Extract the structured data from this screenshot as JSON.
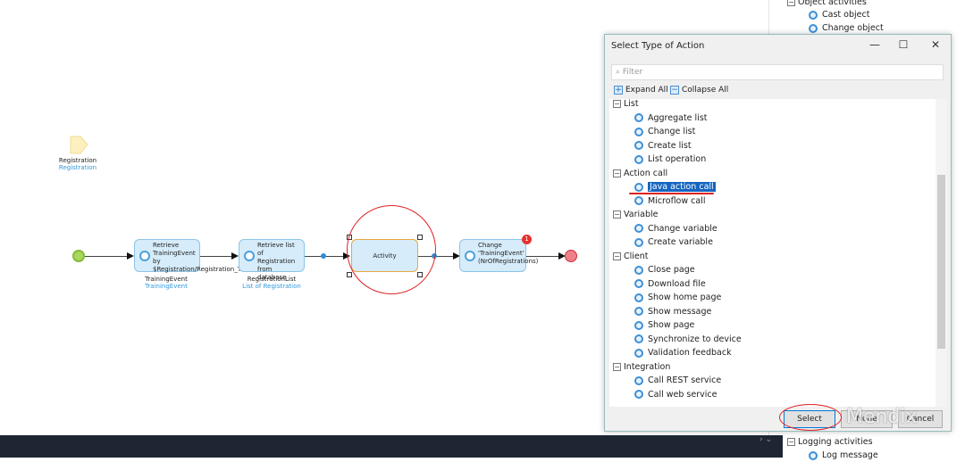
{
  "canvas": {
    "parameter": {
      "name": "Registration",
      "type": "Registration"
    },
    "activities": [
      {
        "text": "Retrieve TrainingEvent by $Registration/Registration_Traini",
        "var": "TrainingEvent",
        "type": "TrainingEvent"
      },
      {
        "text": "Retrieve list of Registration from database",
        "var": "RegistrationList",
        "type": "List of Registration"
      },
      {
        "text": "Activity"
      },
      {
        "text": "Change 'TrainingEvent' (NrOfRegistrations)",
        "badge": "1"
      }
    ]
  },
  "background_panel": {
    "top_category": "Object activities",
    "top_items": [
      "Cast object",
      "Change object"
    ],
    "bottom_category": "Logging activities",
    "bottom_items": [
      "Log message"
    ]
  },
  "dialog": {
    "title": "Select Type of Action",
    "filter_placeholder": "Filter",
    "expand_all": "Expand All",
    "collapse_all": "Collapse All",
    "tree": [
      {
        "category": "List",
        "items": [
          "Aggregate list",
          "Change list",
          "Create list",
          "List operation"
        ]
      },
      {
        "category": "Action call",
        "items": [
          "Java action call",
          "Microflow call"
        ]
      },
      {
        "category": "Variable",
        "items": [
          "Change variable",
          "Create variable"
        ]
      },
      {
        "category": "Client",
        "items": [
          "Close page",
          "Download file",
          "Show home page",
          "Show message",
          "Show page",
          "Synchronize to device",
          "Validation feedback"
        ]
      },
      {
        "category": "Integration",
        "items": [
          "Call REST service",
          "Call web service"
        ]
      }
    ],
    "selected_item": "Java action call",
    "buttons": {
      "select": "Select",
      "none": "None",
      "cancel": "Cancel"
    }
  },
  "watermark": "Mendix",
  "colors": {
    "accent": "#1565c0",
    "activity_fill": "#d6ecfa",
    "start": "#9ad04a",
    "end": "#f07078",
    "annotation": "#e02020"
  }
}
